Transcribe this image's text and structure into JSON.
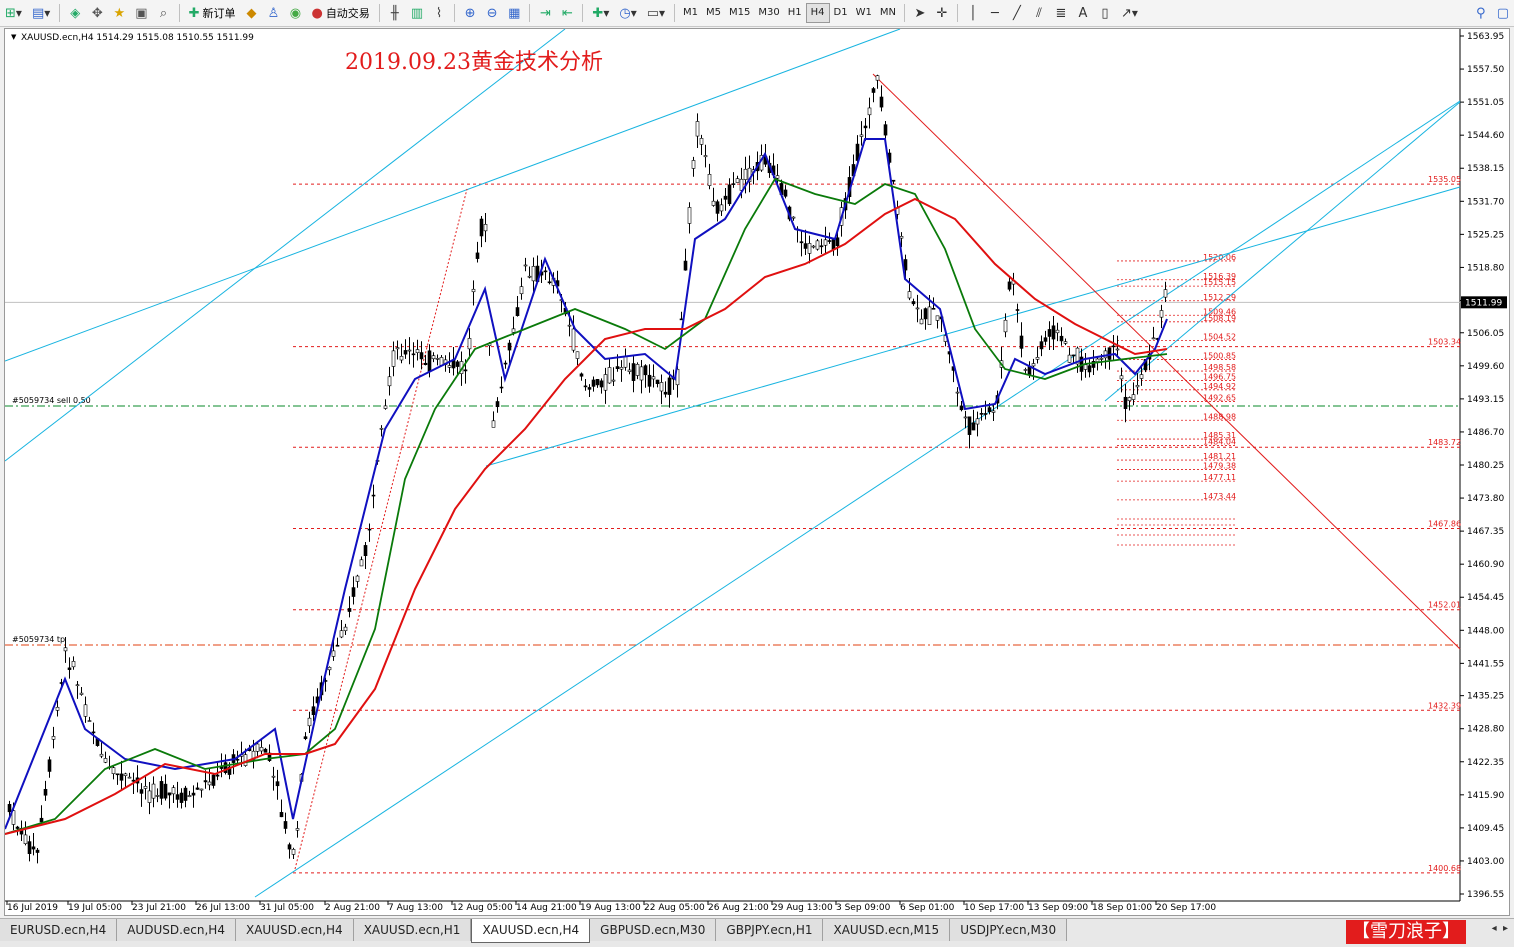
{
  "toolbar": {
    "new_order_label": "新订单",
    "auto_trading_label": "自动交易",
    "timeframes": [
      "M1",
      "M5",
      "M15",
      "M30",
      "H1",
      "H4",
      "D1",
      "W1",
      "MN"
    ],
    "active_timeframe": "H4"
  },
  "chart": {
    "symbol_info": "XAUUSD.ecn,H4  1514.29 1515.08 1510.55 1511.99",
    "title": "2019.09.23黄金技术分析",
    "current_price": "1511.99",
    "order_sell_label": "#5059734 sell 0.50",
    "order_tp_label": "#5059734 tp",
    "price_axis": [
      "1563.95",
      "1557.50",
      "1551.05",
      "1544.60",
      "1538.15",
      "1531.70",
      "1525.25",
      "1518.80",
      "1512.35",
      "1506.05",
      "1499.60",
      "1493.15",
      "1486.70",
      "1480.25",
      "1473.80",
      "1467.35",
      "1460.90",
      "1454.45",
      "1448.00",
      "1441.55",
      "1435.25",
      "1428.80",
      "1422.35",
      "1415.90",
      "1409.45",
      "1403.00",
      "1396.55"
    ],
    "time_axis": [
      "16 Jul 2019",
      "19 Jul 05:00",
      "23 Jul 21:00",
      "26 Jul 13:00",
      "31 Jul 05:00",
      "2 Aug 21:00",
      "7 Aug 13:00",
      "12 Aug 05:00",
      "14 Aug 21:00",
      "19 Aug 13:00",
      "22 Aug 05:00",
      "26 Aug 21:00",
      "29 Aug 13:00",
      "3 Sep 09:00",
      "6 Sep 01:00",
      "10 Sep 17:00",
      "13 Sep 09:00",
      "18 Sep 01:00",
      "20 Sep 17:00"
    ],
    "support_resistance": [
      "1535.05",
      "1503.34",
      "1483.72",
      "1467.86",
      "1452.01",
      "1432.39",
      "1400.68"
    ],
    "fib_levels": [
      "1520.06",
      "1516.39",
      "1515.15",
      "1512.29",
      "1509.46",
      "1508.19",
      "1504.52",
      "1500.85",
      "1498.58",
      "1496.75",
      "1494.92",
      "1492.65",
      "1488.98",
      "1485.31",
      "1484.04",
      "1481.21",
      "1479.38",
      "1477.11",
      "1473.44"
    ],
    "colors": {
      "level_line": "#e21c1c",
      "ma_fast": "#1010c0",
      "ma_mid": "#0a7a0a",
      "ma_slow": "#e01010",
      "channel": "#18b4e0",
      "order_line": "#0a8a2a"
    }
  },
  "tabs": [
    "EURUSD.ecn,H4",
    "AUDUSD.ecn,H4",
    "XAUUSD.ecn,H4",
    "XAUUSD.ecn,H1",
    "XAUUSD.ecn,H4",
    "GBPUSD.ecn,M30",
    "GBPJPY.ecn,H1",
    "XAUUSD.ecn,M15",
    "USDJPY.ecn,M30"
  ],
  "active_tab_index": 4,
  "watermark": "【雪刀浪子】"
}
